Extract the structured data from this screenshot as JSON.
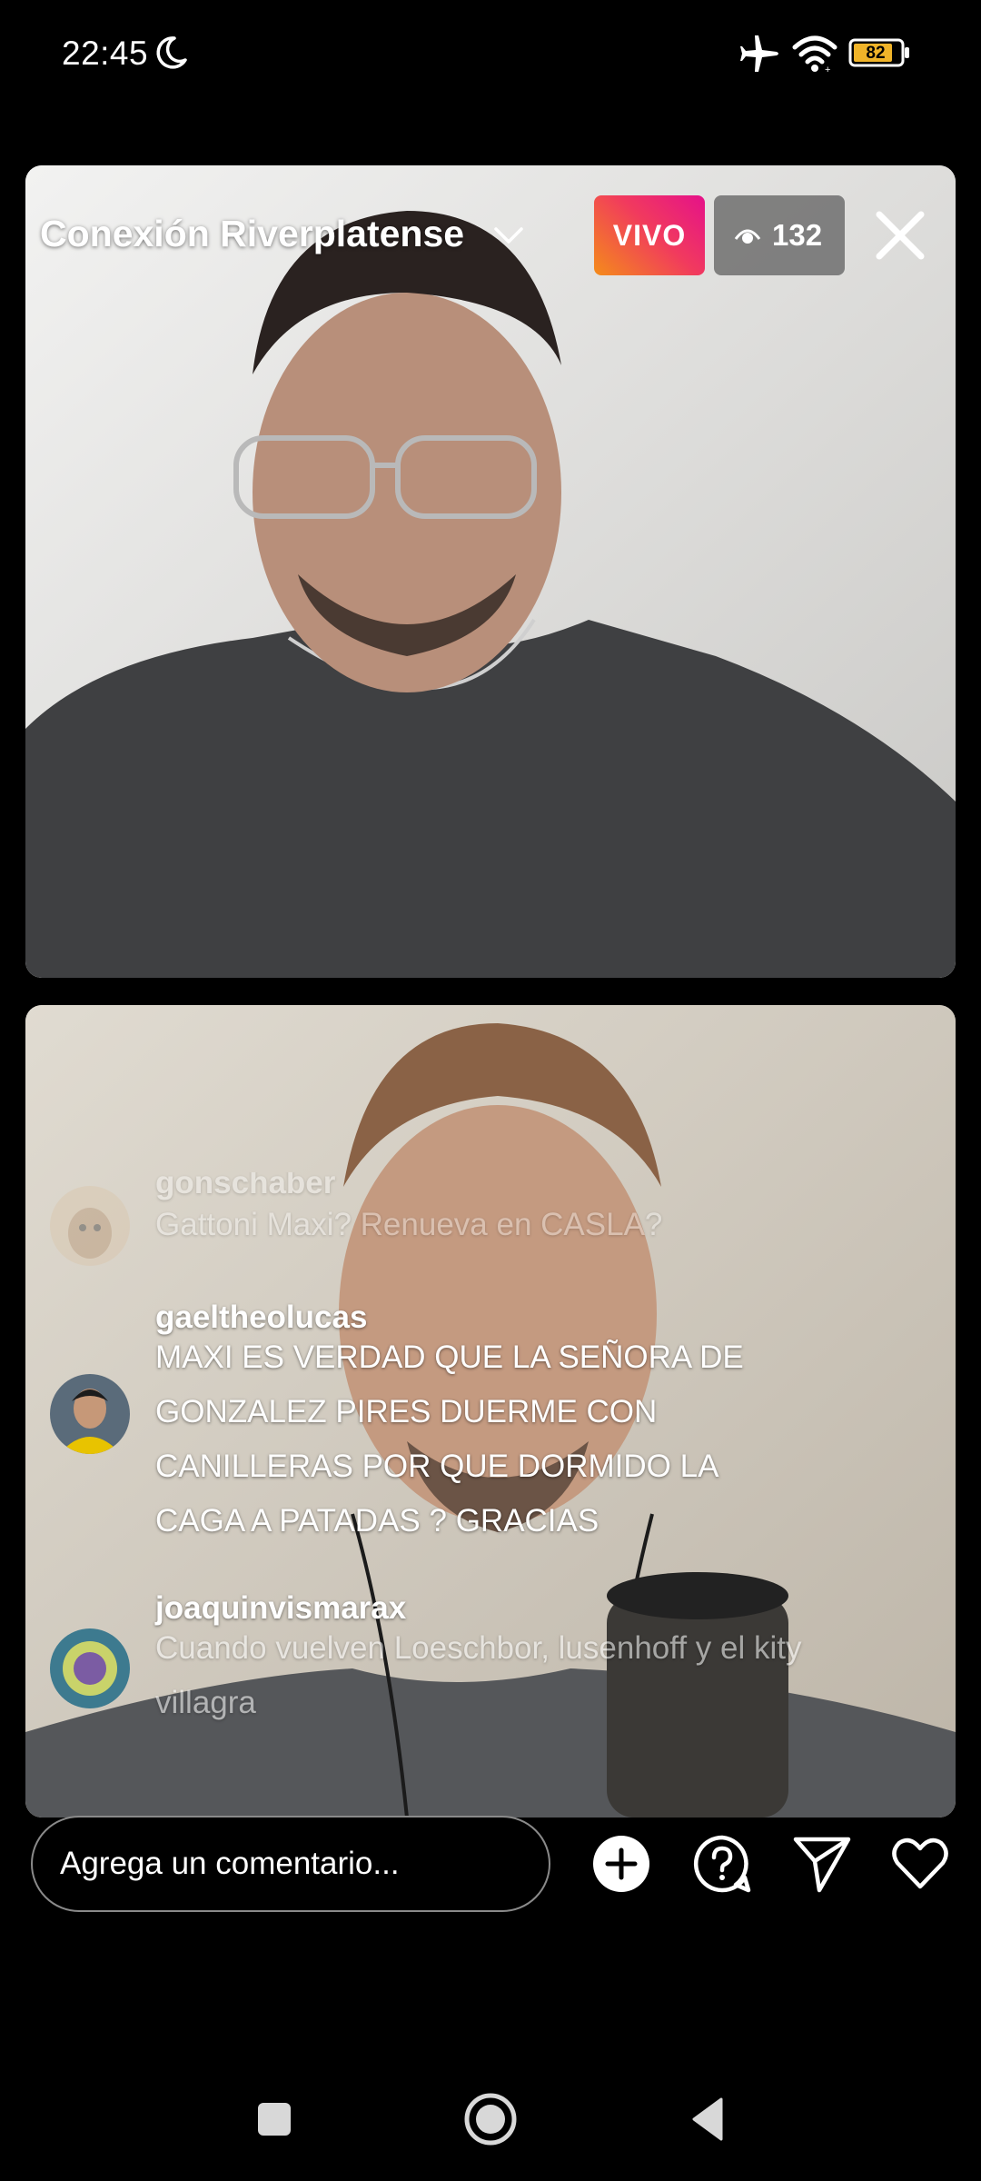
{
  "status_bar": {
    "time": "22:45",
    "battery": "82",
    "icons": [
      "moon-icon",
      "airplane-icon",
      "wifi-icon",
      "battery-icon"
    ]
  },
  "live": {
    "broadcaster": "Conexión Riverplatense",
    "live_label": "VIVO",
    "viewer_count": "132",
    "live_gradient": [
      "#f48c1a",
      "#f13a5e",
      "#e5118a"
    ]
  },
  "comments": [
    {
      "username": "gonschaber",
      "text": "Gattoni Maxi? Renueva en CASLA?"
    },
    {
      "username": "gaeltheolucas",
      "text": "MAXI ES VERDAD QUE LA SEÑORA DE GONZALEZ PIRES DUERME CON CANILLERAS POR QUE DORMIDO LA CAGA A PATADAS ? GRACIAS"
    },
    {
      "username": "joaquinvismarax",
      "text": "Cuando vuelven Loeschbor, lusenhoff y el kity villagra"
    }
  ],
  "composer": {
    "placeholder": "Agrega un comentario...",
    "actions": [
      "add-icon",
      "question-icon",
      "send-icon",
      "heart-icon"
    ]
  },
  "nav": [
    "recent-apps-icon",
    "home-icon",
    "back-icon"
  ]
}
